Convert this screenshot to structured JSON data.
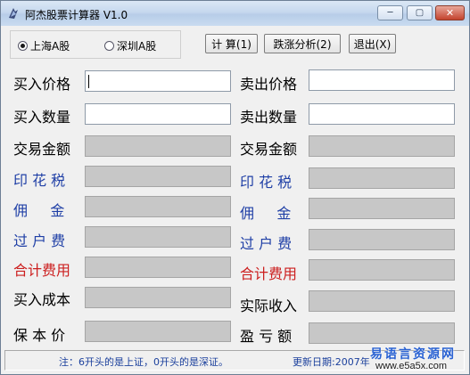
{
  "window": {
    "title": "阿杰股票计算器 V1.0"
  },
  "titlebar_buttons": {
    "minimize": "─",
    "maximize": "▢",
    "close": "✕"
  },
  "market": {
    "shanghai": "上海A股",
    "shenzhen": "深圳A股",
    "selected": "shanghai"
  },
  "buttons": {
    "calc": "计 算(1)",
    "analysis": "跌涨分析(2)",
    "exit": "退出(X)"
  },
  "left": {
    "buy_price": "买入价格",
    "buy_qty": "买入数量",
    "trade_amount": "交易金额",
    "stamp_tax": "印 花 税",
    "commission": "佣     金",
    "transfer_fee": "过 户 费",
    "total_fee": "合计费用",
    "buy_cost": "买入成本",
    "breakeven": "保 本 价"
  },
  "right": {
    "sell_price": "卖出价格",
    "sell_qty": "卖出数量",
    "trade_amount": "交易金额",
    "stamp_tax": "印 花 税",
    "commission": "佣     金",
    "transfer_fee": "过 户 费",
    "total_fee": "合计费用",
    "actual_income": "实际收入",
    "profit_loss": "盈 亏 额"
  },
  "values": {
    "buy_price": "",
    "buy_qty": "",
    "sell_price": "",
    "sell_qty": ""
  },
  "status": {
    "note": "注：6开头的是上证，0开头的是深证。",
    "date": "更新日期:2007年"
  },
  "watermark": {
    "line1": "易语言资源网",
    "line2": "www.e5a5x.com"
  },
  "colors": {
    "label_blue": "#1f3fa6",
    "label_red": "#cc1f1f",
    "readonly_field": "#c7c7c7"
  }
}
